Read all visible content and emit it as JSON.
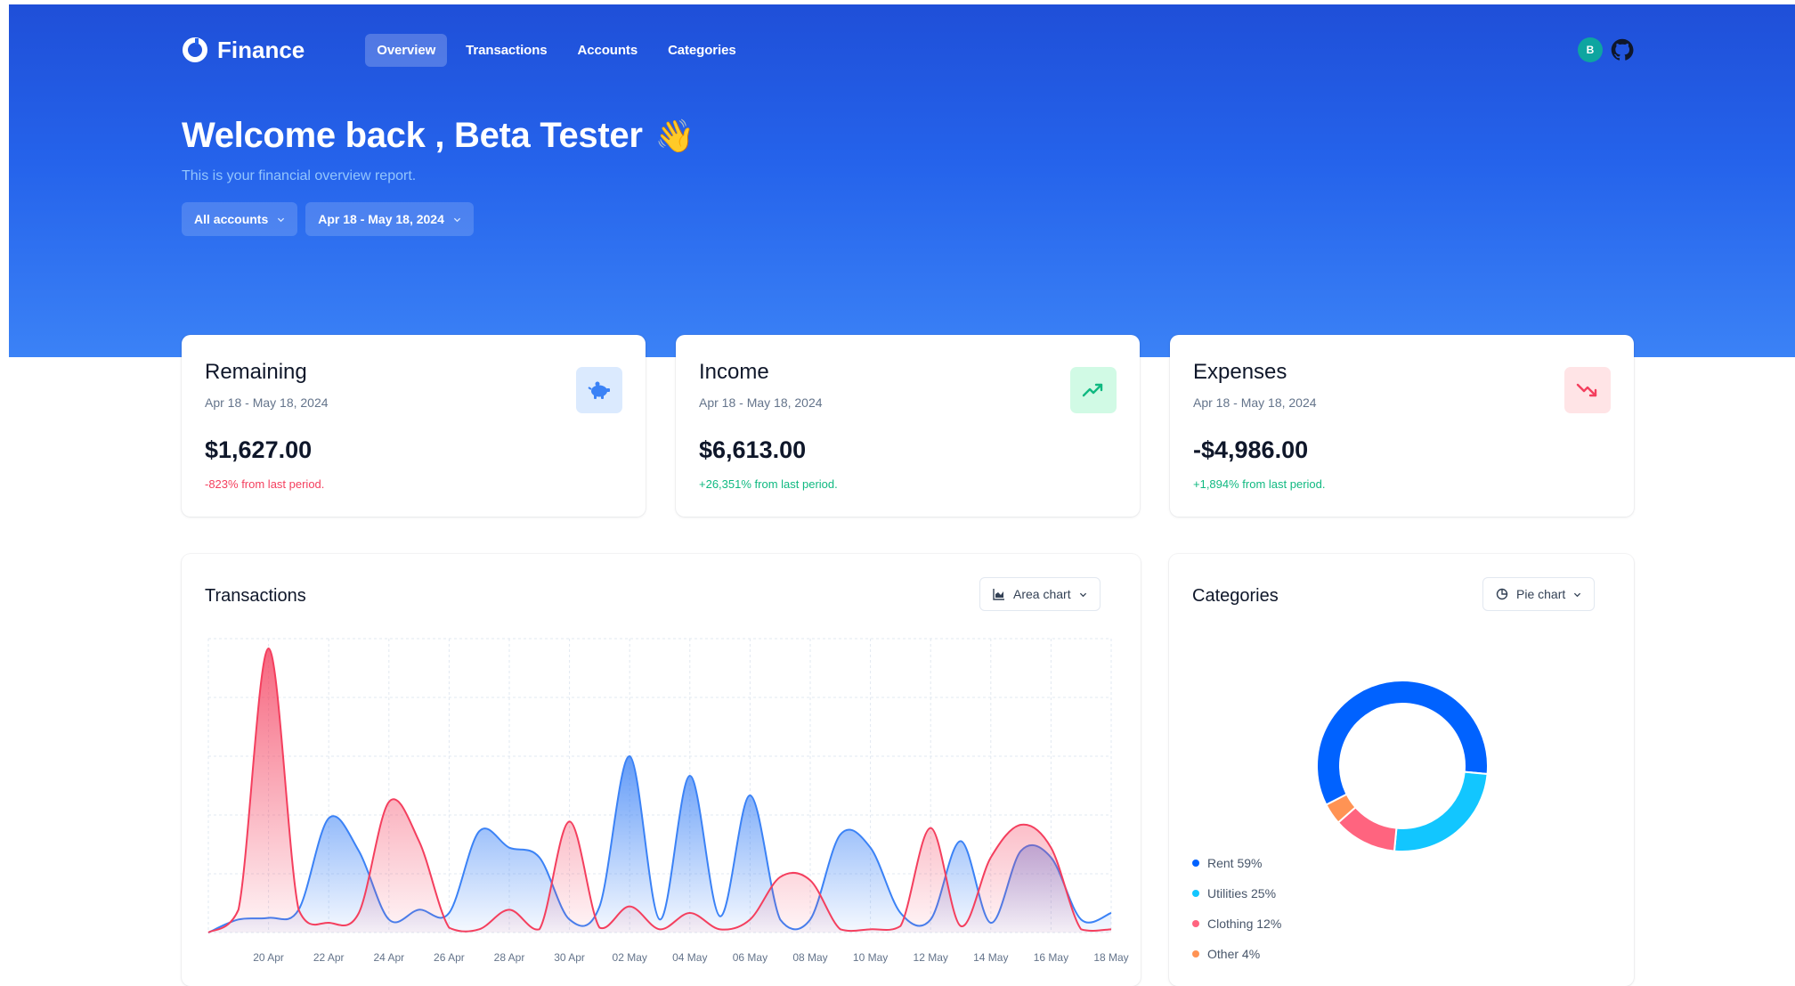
{
  "app": {
    "name": "Finance",
    "nav": [
      {
        "label": "Overview",
        "active": true
      },
      {
        "label": "Transactions",
        "active": false
      },
      {
        "label": "Accounts",
        "active": false
      },
      {
        "label": "Categories",
        "active": false
      }
    ],
    "user_initial": "B",
    "github_icon": "github-icon"
  },
  "hero": {
    "welcome": "Welcome back , Beta Tester",
    "wave_icon": "👋",
    "subtitle": "This is your financial overview report.",
    "account_filter": "All accounts",
    "date_filter": "Apr 18 - May 18, 2024"
  },
  "stats": [
    {
      "title": "Remaining",
      "range": "Apr 18 - May 18, 2024",
      "amount": "$1,627.00",
      "change": "-823% from last period.",
      "trend": "neg",
      "icon": "piggy-bank-icon",
      "icon_bg": "#dbeafe",
      "icon_color": "#3b82f6"
    },
    {
      "title": "Income",
      "range": "Apr 18 - May 18, 2024",
      "amount": "$6,613.00",
      "change": "+26,351% from last period.",
      "trend": "pos",
      "icon": "trending-up-icon",
      "icon_bg": "#d1fae5",
      "icon_color": "#10b981"
    },
    {
      "title": "Expenses",
      "range": "Apr 18 - May 18, 2024",
      "amount": "-$4,986.00",
      "change": "+1,894% from last period.",
      "trend": "pos",
      "icon": "trending-down-icon",
      "icon_bg": "#ffe4e6",
      "icon_color": "#f43f5e"
    }
  ],
  "transactions": {
    "title": "Transactions",
    "chart_type_label": "Area chart"
  },
  "categories": {
    "title": "Categories",
    "chart_type_label": "Pie chart"
  },
  "colors": {
    "income": "#3b82f6",
    "expense": "#f43f5e",
    "rent": "#0062ff",
    "utilities": "#12c6ff",
    "clothing": "#ff647f",
    "other": "#ff9354"
  },
  "chart_data": [
    {
      "type": "area",
      "x": [
        "18 Apr",
        "19 Apr",
        "20 Apr",
        "21 Apr",
        "22 Apr",
        "23 Apr",
        "24 Apr",
        "25 Apr",
        "26 Apr",
        "27 Apr",
        "28 Apr",
        "29 Apr",
        "30 Apr",
        "01 May",
        "02 May",
        "03 May",
        "04 May",
        "05 May",
        "06 May",
        "07 May",
        "08 May",
        "09 May",
        "10 May",
        "11 May",
        "12 May",
        "13 May",
        "14 May",
        "15 May",
        "16 May",
        "17 May",
        "18 May"
      ],
      "x_tick_labels": [
        "20 Apr",
        "22 Apr",
        "24 Apr",
        "26 Apr",
        "28 Apr",
        "30 Apr",
        "02 May",
        "04 May",
        "06 May",
        "08 May",
        "10 May",
        "12 May",
        "14 May",
        "16 May",
        "18 May"
      ],
      "series": [
        {
          "name": "income",
          "values": [
            0,
            40,
            45,
            70,
            350,
            250,
            40,
            70,
            60,
            310,
            260,
            230,
            40,
            80,
            540,
            40,
            480,
            50,
            420,
            40,
            40,
            300,
            260,
            60,
            40,
            280,
            30,
            250,
            230,
            40,
            60
          ]
        },
        {
          "name": "expense",
          "values": [
            0,
            70,
            870,
            70,
            30,
            60,
            400,
            280,
            15,
            10,
            70,
            10,
            340,
            15,
            80,
            10,
            60,
            10,
            40,
            170,
            160,
            10,
            10,
            20,
            320,
            20,
            230,
            330,
            260,
            10,
            10
          ]
        }
      ],
      "grid": true
    },
    {
      "type": "pie",
      "categories": [
        "Rent",
        "Utilities",
        "Clothing",
        "Other"
      ],
      "values": [
        59,
        25,
        12,
        4
      ],
      "legend_labels": [
        "Rent 59%",
        "Utilities 25%",
        "Clothing 12%",
        "Other 4%"
      ]
    }
  ]
}
